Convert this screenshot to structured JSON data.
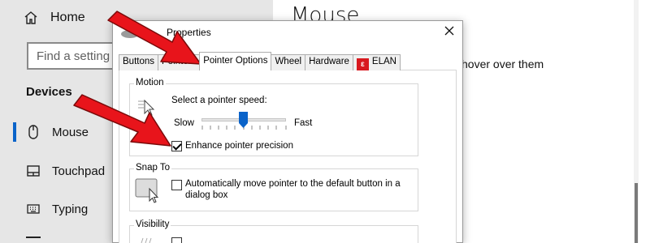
{
  "sidebar": {
    "home_label": "Home",
    "search_placeholder": "Find a setting",
    "section_title": "Devices",
    "items": [
      {
        "label": "Mouse",
        "icon": "mouse-icon",
        "selected": true
      },
      {
        "label": "Touchpad",
        "icon": "touchpad-icon",
        "selected": false
      },
      {
        "label": "Typing",
        "icon": "keyboard-icon",
        "selected": false
      }
    ]
  },
  "content": {
    "title": "Mouse",
    "partial_text": "hover over them"
  },
  "dialog": {
    "title": "Properties",
    "tabs": [
      "Buttons",
      "Pointers",
      "Pointer Options",
      "Wheel",
      "Hardware",
      "ELAN"
    ],
    "active_tab": "Pointer Options",
    "motion": {
      "group_label": "Motion",
      "speed_label": "Select a pointer speed:",
      "slow_label": "Slow",
      "fast_label": "Fast",
      "speed_level": 0.5,
      "precision_label": "Enhance pointer precision",
      "precision_checked": true
    },
    "snap_to": {
      "group_label": "Snap To",
      "label_line1": "Automatically move pointer to the default button in a",
      "label_line2": "dialog box",
      "checked": false
    },
    "visibility": {
      "group_label": "Visibility"
    }
  },
  "colors": {
    "accent": "#0a63c9",
    "arrow": "#e8141b",
    "sidebar_bg": "#e6e6e6"
  }
}
